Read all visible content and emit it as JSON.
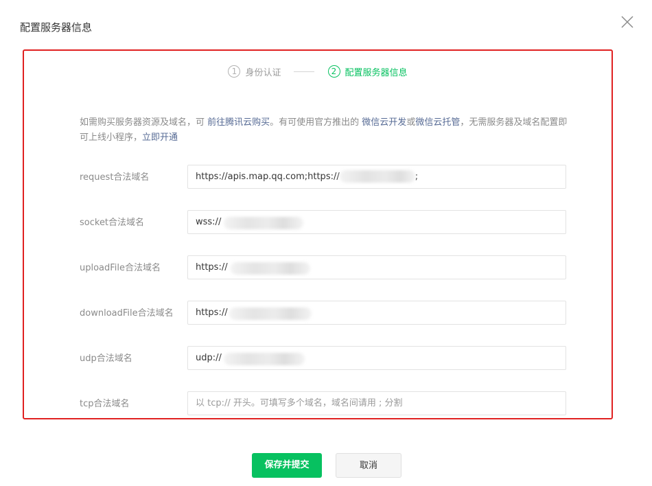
{
  "dialog": {
    "title": "配置服务器信息"
  },
  "steps": [
    {
      "number": "1",
      "label": "身份认证"
    },
    {
      "number": "2",
      "label": "配置服务器信息"
    }
  ],
  "intro": {
    "t1": "如需购买服务器资源及域名，可 ",
    "link1": "前往腾讯云购买",
    "t2": "。有可使用官方推出的 ",
    "link2": "微信云开发",
    "t3": "或",
    "link3": "微信云托管",
    "t4": "，无需服务器及域名配置即可上线小程序，",
    "link4": "立即开通"
  },
  "fields": [
    {
      "label": "request合法域名",
      "value": "https://apis.map.qq.com;https://",
      "suffix": ";",
      "placeholder": ""
    },
    {
      "label": "socket合法域名",
      "value": "wss://",
      "suffix": "",
      "placeholder": ""
    },
    {
      "label": "uploadFile合法域名",
      "value": "https://",
      "suffix": "",
      "placeholder": ""
    },
    {
      "label": "downloadFile合法域名",
      "value": "https://",
      "suffix": "",
      "placeholder": ""
    },
    {
      "label": "udp合法域名",
      "value": "udp://",
      "suffix": "",
      "placeholder": ""
    },
    {
      "label": "tcp合法域名",
      "value": "",
      "suffix": "",
      "placeholder": "以 tcp:// 开头。可填写多个域名，域名间请用 ; 分割"
    }
  ],
  "buttons": {
    "submit": "保存并提交",
    "cancel": "取消"
  },
  "colors": {
    "accent": "#07c160",
    "link": "#576b95",
    "highlight_border": "#e02020"
  }
}
